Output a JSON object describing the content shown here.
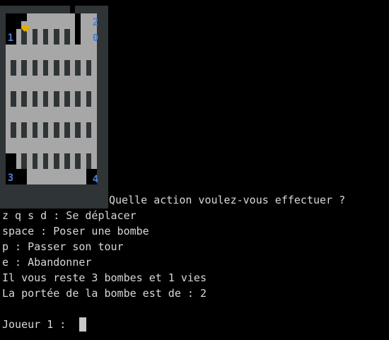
{
  "colors": {
    "background": "#000000",
    "text": "#d8d8d8",
    "wall": "#2f3436",
    "floor": "#a7a7a7",
    "player_number": "#4a7fd0",
    "heart": "#e0b000"
  },
  "board": {
    "rows": [
      "WWWWWWWWWWWWW.WWWWWW",
      "W..HHFFFFFFFFF.FFFWW",
      "W...FFFFFFFFFF.FFFWW",
      "W..FWFWFWFWFWF.FFFWW",
      "W..FWFWFWFWFWF.FFFWW",
      "WFFFFFFFFFFFFFFFFFWW",
      "WFFFFFFFFFFFFFFFFFWW",
      "WFWFWFWFWFWFWFWFWFWW",
      "WFWFWFWFWFWFWFWFWFWW",
      "WFFFFFFFFFFFFFFFFFWW",
      "WFFFFFFFFFFFFFFFFFWW",
      "WFWFWFWFWFWFWFWFWFWW",
      "WFWFWFWFWFWFWFWFWFWW",
      "WFFFFFFFFFFFFFFFFFWW",
      "WFFFFFFFFFFFFFFFFFWW",
      "WFWFWFWFWFWFWFWFWFWW",
      "WFWFWFWFWFWFWFWFWFWW",
      "WFFFFFFFFFFFFFFFFFWW",
      "WFFFFFFFFFFFFFFFFFWW",
      "W..FWFWFWFWFWFWFWFWW",
      "W..FWFWFWFWFWFWFWFWW",
      "W....FFFFFFFFFFF..WW",
      "W....FFFFFFFFFFF..WW",
      "WWWWWWWWWWWWWWWWWWWW",
      "WWWWWWWWWWWWWWWWWWWW",
      "WWWWWWWWWWWWWWWWWWWW"
    ],
    "players": [
      {
        "label": "1",
        "position": "top-left"
      },
      {
        "label": "2",
        "position": "top-right"
      },
      {
        "label": "0",
        "position": "right"
      },
      {
        "label": "3",
        "position": "bottom-left"
      },
      {
        "label": "4",
        "position": "bottom-right"
      }
    ],
    "hearts": "♥♥"
  },
  "console": {
    "prompt_question": "Quelle action voulez-vous effectuer ?",
    "lines": [
      "z q s d : Se déplacer",
      "space : Poser une bombe",
      "p : Passer son tour",
      "e : Abandonner",
      "Il vous reste 3 bombes et 1 vies",
      "La portée de la bombe est de : 2"
    ],
    "input_prompt": "Joueur 1 : "
  }
}
